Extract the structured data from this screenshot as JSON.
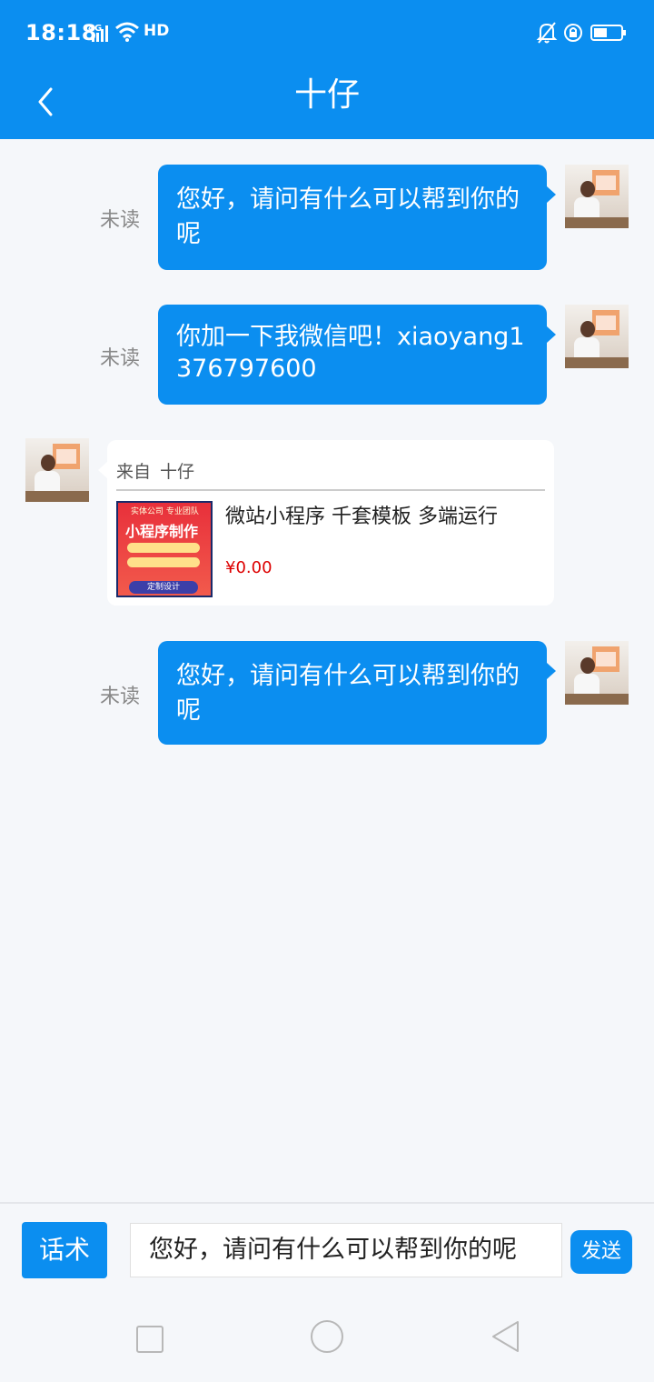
{
  "status": {
    "time": "18:18",
    "network": "4G",
    "hd": "HD"
  },
  "header": {
    "title": "十仔",
    "back_icon": "chevron-left-icon"
  },
  "messages": [
    {
      "unread_label": "未读",
      "text": "您好，请问有什么可以帮到你的呢"
    },
    {
      "unread_label": "未读",
      "text": "你加一下我微信吧！xiaoyang1376797600"
    },
    {
      "unread_label": "未读",
      "text": "您好，请问有什么可以帮到你的呢"
    }
  ],
  "card": {
    "from_label": "来自",
    "from_name": "十仔",
    "product_title": "微站小程序 千套模板 多端运行",
    "price": "¥0.00",
    "thumb": {
      "top_text": "实体公司 专业团队",
      "main_text": "小程序制作",
      "button_text": "定制设计"
    }
  },
  "input": {
    "script_button": "话术",
    "text": "您好，请问有什么可以帮到你的呢",
    "send_button": "发送"
  },
  "colors": {
    "accent": "#0b8ef0",
    "price": "#dd0000"
  }
}
